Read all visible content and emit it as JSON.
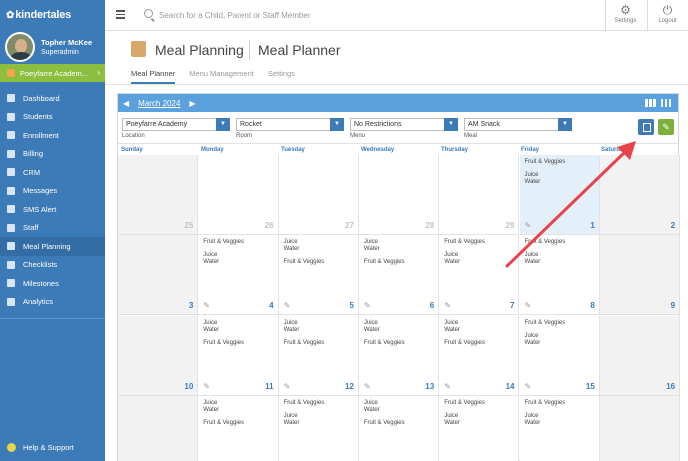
{
  "app": {
    "logo": "kindertales",
    "user_name": "Topher McKee",
    "user_role": "Superadmin",
    "school_name": "Poeyfarre Academ...",
    "nav": [
      {
        "label": "Dashboard",
        "icon": "dashboard-icon"
      },
      {
        "label": "Students",
        "icon": "students-icon"
      },
      {
        "label": "Enrollment",
        "icon": "enrollment-icon"
      },
      {
        "label": "Billing",
        "icon": "billing-icon"
      },
      {
        "label": "CRM",
        "icon": "crm-icon"
      },
      {
        "label": "Messages",
        "icon": "messages-icon"
      },
      {
        "label": "SMS Alert",
        "icon": "sms-icon"
      },
      {
        "label": "Staff",
        "icon": "staff-icon"
      },
      {
        "label": "Meal Planning",
        "icon": "meal-icon",
        "active": true
      },
      {
        "label": "Checklists",
        "icon": "checklist-icon"
      },
      {
        "label": "Milestones",
        "icon": "milestone-icon"
      },
      {
        "label": "Analytics",
        "icon": "analytics-icon"
      }
    ],
    "help": "Help & Support"
  },
  "topbar": {
    "search_placeholder": "Search for a Child, Parent or Staff Member",
    "settings_label": "Settings",
    "logout_label": "Logout"
  },
  "page": {
    "title": "Meal Planning",
    "subtitle": "Meal Planner",
    "tabs": [
      "Meal Planner",
      "Menu Management",
      "Settings"
    ],
    "active_tab": "Meal Planner"
  },
  "calendar": {
    "month": "March 2024",
    "filters": [
      {
        "value": "Poeyfarre Academy",
        "label": "Location"
      },
      {
        "value": "Rocket",
        "label": "Room"
      },
      {
        "value": "No Restrictions",
        "label": "Menu"
      },
      {
        "value": "AM Snack",
        "label": "Meal"
      }
    ],
    "days_of_week": [
      "Sunday",
      "Monday",
      "Tuesday",
      "Wednesday",
      "Thursday",
      "Friday",
      "Saturday"
    ],
    "weeks": [
      [
        {
          "day": "25",
          "gray": true,
          "faded": true,
          "meals": []
        },
        {
          "day": "26",
          "gray": false,
          "faded": true,
          "meals": []
        },
        {
          "day": "27",
          "gray": false,
          "faded": true,
          "meals": []
        },
        {
          "day": "28",
          "gray": false,
          "faded": true,
          "meals": []
        },
        {
          "day": "29",
          "gray": false,
          "faded": true,
          "meals": []
        },
        {
          "day": "1",
          "today": true,
          "pencil": true,
          "meals": [
            "Fruit & Veggies",
            "",
            "Juice",
            "Water"
          ]
        },
        {
          "day": "2",
          "gray": true,
          "meals": []
        }
      ],
      [
        {
          "day": "3",
          "gray": true,
          "meals": []
        },
        {
          "day": "4",
          "pencil": true,
          "meals": [
            "Fruit & Veggies",
            "",
            "Juice",
            "Water"
          ]
        },
        {
          "day": "5",
          "pencil": true,
          "meals": [
            "Juice",
            "Water",
            "",
            "Fruit & Veggies"
          ]
        },
        {
          "day": "6",
          "pencil": true,
          "meals": [
            "Juice",
            "Water",
            "",
            "Fruit & Veggies"
          ]
        },
        {
          "day": "7",
          "pencil": true,
          "meals": [
            "Fruit & Veggies",
            "",
            "Juice",
            "Water"
          ]
        },
        {
          "day": "8",
          "pencil": true,
          "meals": [
            "Fruit & Veggies",
            "",
            "Juice",
            "Water"
          ]
        },
        {
          "day": "9",
          "gray": true,
          "meals": []
        }
      ],
      [
        {
          "day": "10",
          "gray": true,
          "meals": []
        },
        {
          "day": "11",
          "pencil": true,
          "meals": [
            "Juice",
            "Water",
            "",
            "Fruit & Veggies"
          ]
        },
        {
          "day": "12",
          "pencil": true,
          "meals": [
            "Juice",
            "Water",
            "",
            "Fruit & Veggies"
          ]
        },
        {
          "day": "13",
          "pencil": true,
          "meals": [
            "Juice",
            "Water",
            "",
            "Fruit & Veggies"
          ]
        },
        {
          "day": "14",
          "pencil": true,
          "meals": [
            "Juice",
            "Water",
            "",
            "Fruit & Veggies"
          ]
        },
        {
          "day": "15",
          "pencil": true,
          "meals": [
            "Fruit & Veggies",
            "",
            "Juice",
            "Water"
          ]
        },
        {
          "day": "16",
          "gray": true,
          "meals": []
        }
      ],
      [
        {
          "day": "",
          "gray": true,
          "meals": []
        },
        {
          "day": "",
          "meals": [
            "Juice",
            "Water",
            "",
            "Fruit & Veggies"
          ]
        },
        {
          "day": "",
          "meals": [
            "Fruit & Veggies",
            "",
            "Juice",
            "Water"
          ]
        },
        {
          "day": "",
          "meals": [
            "Juice",
            "Water",
            "",
            "Fruit & Veggies"
          ]
        },
        {
          "day": "",
          "meals": [
            "Fruit & Veggies",
            "",
            "Juice",
            "Water"
          ]
        },
        {
          "day": "",
          "meals": [
            "Fruit & Veggies",
            "",
            "Juice",
            "Water"
          ]
        },
        {
          "day": "",
          "gray": true,
          "meals": []
        }
      ]
    ]
  },
  "colors": {
    "accent": "#3d7ab8",
    "arrow": "#e8434a",
    "school_bar": "#8cbf3f"
  }
}
